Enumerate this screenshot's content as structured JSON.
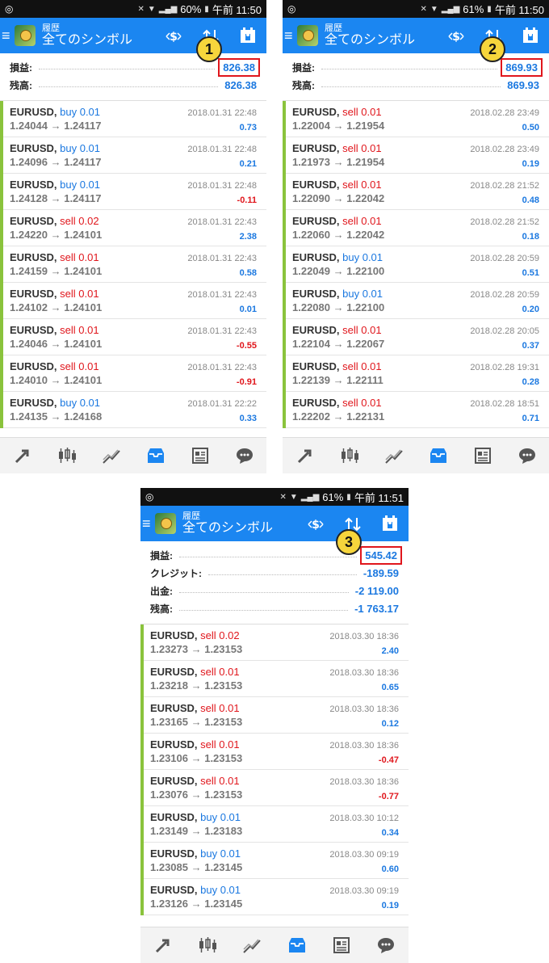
{
  "screens": [
    {
      "status": {
        "battery": "60%",
        "time": "午前 11:50"
      },
      "header": {
        "subtitle": "履歴",
        "title": "全てのシンボル"
      },
      "summary": [
        {
          "label": "損益:",
          "value": "826.38",
          "highlight": true
        },
        {
          "label": "残高:",
          "value": "826.38",
          "highlight": false
        }
      ],
      "badge": "1",
      "trades": [
        {
          "symbol": "EURUSD,",
          "type": "buy 0.01",
          "side": "buy",
          "prices": "1.24044 → 1.24117",
          "date": "2018.01.31 22:48",
          "pl": "0.73"
        },
        {
          "symbol": "EURUSD,",
          "type": "buy 0.01",
          "side": "buy",
          "prices": "1.24096 → 1.24117",
          "date": "2018.01.31 22:48",
          "pl": "0.21"
        },
        {
          "symbol": "EURUSD,",
          "type": "buy 0.01",
          "side": "buy",
          "prices": "1.24128 → 1.24117",
          "date": "2018.01.31 22:48",
          "pl": "-0.11"
        },
        {
          "symbol": "EURUSD,",
          "type": "sell 0.02",
          "side": "sell",
          "prices": "1.24220 → 1.24101",
          "date": "2018.01.31 22:43",
          "pl": "2.38"
        },
        {
          "symbol": "EURUSD,",
          "type": "sell 0.01",
          "side": "sell",
          "prices": "1.24159 → 1.24101",
          "date": "2018.01.31 22:43",
          "pl": "0.58"
        },
        {
          "symbol": "EURUSD,",
          "type": "sell 0.01",
          "side": "sell",
          "prices": "1.24102 → 1.24101",
          "date": "2018.01.31 22:43",
          "pl": "0.01"
        },
        {
          "symbol": "EURUSD,",
          "type": "sell 0.01",
          "side": "sell",
          "prices": "1.24046 → 1.24101",
          "date": "2018.01.31 22:43",
          "pl": "-0.55"
        },
        {
          "symbol": "EURUSD,",
          "type": "sell 0.01",
          "side": "sell",
          "prices": "1.24010 → 1.24101",
          "date": "2018.01.31 22:43",
          "pl": "-0.91"
        },
        {
          "symbol": "EURUSD,",
          "type": "buy 0.01",
          "side": "buy",
          "prices": "1.24135 → 1.24168",
          "date": "2018.01.31 22:22",
          "pl": "0.33"
        }
      ]
    },
    {
      "status": {
        "battery": "61%",
        "time": "午前 11:50"
      },
      "header": {
        "subtitle": "履歴",
        "title": "全てのシンボル"
      },
      "summary": [
        {
          "label": "損益:",
          "value": "869.93",
          "highlight": true
        },
        {
          "label": "残高:",
          "value": "869.93",
          "highlight": false
        }
      ],
      "badge": "2",
      "trades": [
        {
          "symbol": "EURUSD,",
          "type": "sell 0.01",
          "side": "sell",
          "prices": "1.22004 → 1.21954",
          "date": "2018.02.28 23:49",
          "pl": "0.50"
        },
        {
          "symbol": "EURUSD,",
          "type": "sell 0.01",
          "side": "sell",
          "prices": "1.21973 → 1.21954",
          "date": "2018.02.28 23:49",
          "pl": "0.19"
        },
        {
          "symbol": "EURUSD,",
          "type": "sell 0.01",
          "side": "sell",
          "prices": "1.22090 → 1.22042",
          "date": "2018.02.28 21:52",
          "pl": "0.48"
        },
        {
          "symbol": "EURUSD,",
          "type": "sell 0.01",
          "side": "sell",
          "prices": "1.22060 → 1.22042",
          "date": "2018.02.28 21:52",
          "pl": "0.18"
        },
        {
          "symbol": "EURUSD,",
          "type": "buy 0.01",
          "side": "buy",
          "prices": "1.22049 → 1.22100",
          "date": "2018.02.28 20:59",
          "pl": "0.51"
        },
        {
          "symbol": "EURUSD,",
          "type": "buy 0.01",
          "side": "buy",
          "prices": "1.22080 → 1.22100",
          "date": "2018.02.28 20:59",
          "pl": "0.20"
        },
        {
          "symbol": "EURUSD,",
          "type": "sell 0.01",
          "side": "sell",
          "prices": "1.22104 → 1.22067",
          "date": "2018.02.28 20:05",
          "pl": "0.37"
        },
        {
          "symbol": "EURUSD,",
          "type": "sell 0.01",
          "side": "sell",
          "prices": "1.22139 → 1.22111",
          "date": "2018.02.28 19:31",
          "pl": "0.28"
        },
        {
          "symbol": "EURUSD,",
          "type": "sell 0.01",
          "side": "sell",
          "prices": "1.22202 → 1.22131",
          "date": "2018.02.28 18:51",
          "pl": "0.71"
        }
      ]
    },
    {
      "status": {
        "battery": "61%",
        "time": "午前 11:51"
      },
      "header": {
        "subtitle": "履歴",
        "title": "全てのシンボル"
      },
      "summary": [
        {
          "label": "損益:",
          "value": "545.42",
          "highlight": true
        },
        {
          "label": "クレジット:",
          "value": "-189.59",
          "highlight": false
        },
        {
          "label": "出金:",
          "value": "-2 119.00",
          "highlight": false
        },
        {
          "label": "残高:",
          "value": "-1 763.17",
          "highlight": false
        }
      ],
      "badge": "3",
      "trades": [
        {
          "symbol": "EURUSD,",
          "type": "sell 0.02",
          "side": "sell",
          "prices": "1.23273 → 1.23153",
          "date": "2018.03.30 18:36",
          "pl": "2.40"
        },
        {
          "symbol": "EURUSD,",
          "type": "sell 0.01",
          "side": "sell",
          "prices": "1.23218 → 1.23153",
          "date": "2018.03.30 18:36",
          "pl": "0.65"
        },
        {
          "symbol": "EURUSD,",
          "type": "sell 0.01",
          "side": "sell",
          "prices": "1.23165 → 1.23153",
          "date": "2018.03.30 18:36",
          "pl": "0.12"
        },
        {
          "symbol": "EURUSD,",
          "type": "sell 0.01",
          "side": "sell",
          "prices": "1.23106 → 1.23153",
          "date": "2018.03.30 18:36",
          "pl": "-0.47"
        },
        {
          "symbol": "EURUSD,",
          "type": "sell 0.01",
          "side": "sell",
          "prices": "1.23076 → 1.23153",
          "date": "2018.03.30 18:36",
          "pl": "-0.77"
        },
        {
          "symbol": "EURUSD,",
          "type": "buy 0.01",
          "side": "buy",
          "prices": "1.23149 → 1.23183",
          "date": "2018.03.30 10:12",
          "pl": "0.34"
        },
        {
          "symbol": "EURUSD,",
          "type": "buy 0.01",
          "side": "buy",
          "prices": "1.23085 → 1.23145",
          "date": "2018.03.30 09:19",
          "pl": "0.60"
        },
        {
          "symbol": "EURUSD,",
          "type": "buy 0.01",
          "side": "buy",
          "prices": "1.23126 → 1.23145",
          "date": "2018.03.30 09:19",
          "pl": "0.19"
        }
      ]
    }
  ],
  "colors": {
    "header": "#1b86f1",
    "buy": "#1b78e0",
    "sell": "#e0161c",
    "accent_bar": "#8ac33c",
    "badge": "#f6d53c",
    "highlight_box": "#e0161c"
  },
  "nav_icons": [
    "trade-icon",
    "quotes-chart-icon",
    "chart-icon",
    "history-icon",
    "news-icon",
    "chat-icon"
  ]
}
